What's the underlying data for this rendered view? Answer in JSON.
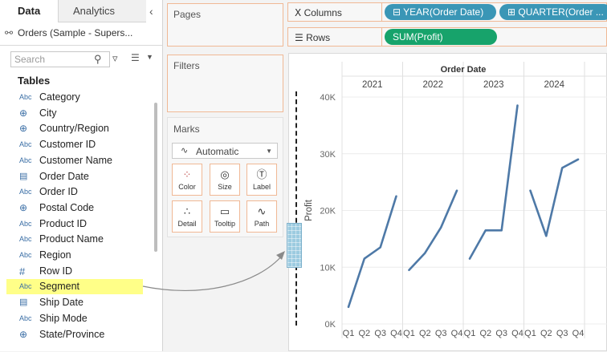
{
  "data_pane": {
    "tabs": [
      {
        "label": "Data",
        "active": true
      },
      {
        "label": "Analytics",
        "active": false
      }
    ],
    "collapse_icon": "chevron-left-icon",
    "datasource": "Orders (Sample - Supers...",
    "search": {
      "placeholder": "Search",
      "value": ""
    },
    "tables_heading": "Tables",
    "fields": [
      {
        "type": "Abc",
        "icon": "abc-icon",
        "label": "Category"
      },
      {
        "type": "",
        "icon": "globe-icon",
        "label": "City"
      },
      {
        "type": "",
        "icon": "globe-icon",
        "label": "Country/Region"
      },
      {
        "type": "Abc",
        "icon": "abc-icon",
        "label": "Customer ID"
      },
      {
        "type": "Abc",
        "icon": "abc-icon",
        "label": "Customer Name"
      },
      {
        "type": "",
        "icon": "calendar-icon",
        "label": "Order Date"
      },
      {
        "type": "Abc",
        "icon": "abc-icon",
        "label": "Order ID"
      },
      {
        "type": "",
        "icon": "globe-icon",
        "label": "Postal Code"
      },
      {
        "type": "Abc",
        "icon": "abc-icon",
        "label": "Product ID"
      },
      {
        "type": "Abc",
        "icon": "abc-icon",
        "label": "Product Name"
      },
      {
        "type": "Abc",
        "icon": "abc-icon",
        "label": "Region"
      },
      {
        "type": "#",
        "icon": "hash-icon",
        "label": "Row ID"
      },
      {
        "type": "Abc",
        "icon": "abc-icon",
        "label": "Segment"
      },
      {
        "type": "",
        "icon": "calendar-icon",
        "label": "Ship Date"
      },
      {
        "type": "Abc",
        "icon": "abc-icon",
        "label": "Ship Mode"
      },
      {
        "type": "",
        "icon": "globe-icon",
        "label": "State/Province"
      }
    ],
    "highlight_color": "#ffff88"
  },
  "cards": {
    "pages": "Pages",
    "filters": "Filters",
    "marks": "Marks",
    "mark_type": "Automatic",
    "mark_buttons": [
      {
        "label": "Color",
        "icon": "color-icon"
      },
      {
        "label": "Size",
        "icon": "size-icon"
      },
      {
        "label": "Label",
        "icon": "label-icon"
      },
      {
        "label": "Detail",
        "icon": "detail-icon"
      },
      {
        "label": "Tooltip",
        "icon": "tooltip-icon"
      },
      {
        "label": "Path",
        "icon": "path-icon"
      }
    ]
  },
  "shelves": {
    "columns_label": "Columns",
    "rows_label": "Rows",
    "column_pills": [
      "YEAR(Order Date)",
      "QUARTER(Order ..."
    ],
    "row_pills": [
      "SUM(Profit)"
    ]
  },
  "colors": {
    "line": "#4e79a7",
    "pill_blue": "#3a96b6",
    "pill_green": "#17a36b",
    "card_border": "#f0b895",
    "drop_zone": "#9ccbe0"
  },
  "chart_data": {
    "type": "line",
    "title": "Order Date",
    "ylabel": "Profit",
    "ylim": [
      0,
      40000
    ],
    "yticks": [
      "0K",
      "10K",
      "20K",
      "30K",
      "40K"
    ],
    "panels": [
      "2021",
      "2022",
      "2023",
      "2024"
    ],
    "quarters": [
      "Q1",
      "Q2",
      "Q3",
      "Q4"
    ],
    "series": [
      {
        "year": "2021",
        "values": [
          3000,
          11500,
          13500,
          22500
        ]
      },
      {
        "year": "2022",
        "values": [
          9500,
          12500,
          17000,
          23500
        ]
      },
      {
        "year": "2023",
        "values": [
          11500,
          16500,
          16500,
          38500
        ]
      },
      {
        "year": "2024",
        "values": [
          23500,
          15500,
          27500,
          29000
        ]
      }
    ]
  }
}
